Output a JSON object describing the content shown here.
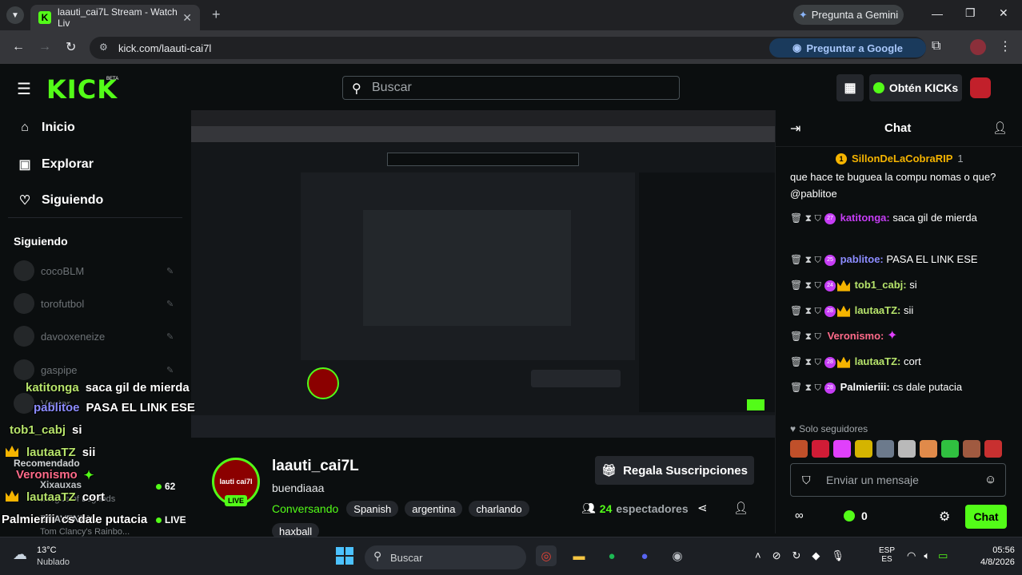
{
  "browser": {
    "tab_title": "laauti_cai7L Stream - Watch Liv",
    "tab_logo": "K",
    "url": "kick.com/laauti-cai7l",
    "gemini": "Pregunta a Gemini",
    "google_btn": "Preguntar a Google"
  },
  "header": {
    "logo": "KICK",
    "beta": "BETA",
    "search_placeholder": "Buscar",
    "kicks_btn": "Obtén KICKs"
  },
  "sidebar": {
    "nav": [
      {
        "label": "Inicio",
        "icon": "home-icon"
      },
      {
        "label": "Explorar",
        "icon": "compass-icon"
      },
      {
        "label": "Siguiendo",
        "icon": "heart-icon"
      }
    ],
    "following_header": "Siguiendo",
    "following": [
      "cocoBLM",
      "torofutbol",
      "davooxeneize",
      "gaspipe",
      "Vector"
    ],
    "recommended": "Recomendado",
    "rec_items": [
      {
        "name": "Xixauxas",
        "viewers": "62"
      },
      {
        "name": "BRAVENIKA",
        "viewers": "LIVE"
      }
    ],
    "rec_sub": "League of Legends",
    "rec_sub2": "Tom Clancy's Rainbo..."
  },
  "overlay_chat": [
    {
      "user": "katitonga",
      "text": "saca gil de mierda",
      "color": "#b6e36b"
    },
    {
      "user": "pablitoe",
      "text": "PASA EL LINK ESE",
      "color": "#8c8cff"
    },
    {
      "user": "tob1_cabj",
      "text": "si",
      "color": "#b6e36b"
    },
    {
      "user": "lautaaTZ",
      "text": "sii",
      "color": "#b6e36b"
    },
    {
      "user": "Veronismo",
      "text": "",
      "color": "#ff6b8a"
    },
    {
      "user": "lautaaTZ",
      "text": "cort",
      "color": "#b6e36b"
    },
    {
      "user": "Palmieriii",
      "text": "cs dale putacia",
      "color": "#ffffff"
    }
  ],
  "stream": {
    "name": "laauti_cai7L",
    "title": "buendiaaa",
    "category": "Conversando",
    "tags": [
      "Spanish",
      "argentina",
      "charlando",
      "haxball"
    ],
    "viewers": "24",
    "viewers_label": "espectadores",
    "gift_btn": "Regala Suscripciones",
    "live": "LIVE",
    "avatar_text": "lauti cai7l"
  },
  "chat": {
    "title": "Chat",
    "pinned_user": "SillonDeLaCobraRIP",
    "pinned_count": "1",
    "messages": [
      {
        "user": "",
        "text": "que hace te buguea la compu nomas o que? @pablitoe",
        "color": "#ffffff"
      },
      {
        "user": "katitonga:",
        "text": "saca gil de mierda",
        "color": "#c63df5",
        "sub": "27"
      },
      {
        "user": "pablitoe:",
        "text": "PASA EL LINK ESE",
        "color": "#8c8cff",
        "sub": "25"
      },
      {
        "user": "tob1_cabj:",
        "text": "si",
        "color": "#b6e36b",
        "sub": "24"
      },
      {
        "user": "lautaaTZ:",
        "text": "sii",
        "color": "#b6e36b",
        "sub": "28"
      },
      {
        "user": "Veronismo:",
        "text": "",
        "color": "#ff6b8a",
        "sub": ""
      },
      {
        "user": "lautaaTZ:",
        "text": "cort",
        "color": "#b6e36b",
        "sub": "28"
      },
      {
        "user": "Palmieriii:",
        "text": "cs dale putacia",
        "color": "#ffffff",
        "sub": "28"
      }
    ],
    "followers_only": "Solo seguidores",
    "input_placeholder": "Enviar un mensaje",
    "kicks_count": "0",
    "chat_btn": "Chat"
  },
  "taskbar": {
    "temp": "13°C",
    "weather": "Nublado",
    "search": "Buscar",
    "lang1": "ESP",
    "lang2": "ES",
    "time": "05:56",
    "date": "4/8/2026"
  },
  "colors": {
    "accent": "#53fc18",
    "bg": "#0b0e0f"
  }
}
